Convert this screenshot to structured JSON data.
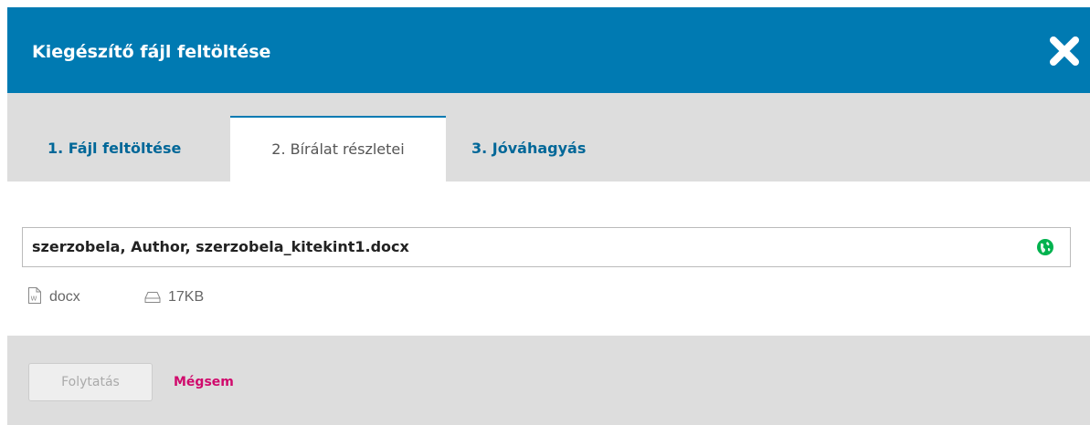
{
  "dialog": {
    "title": "Kiegészítő fájl feltöltése",
    "close_icon": "close-icon"
  },
  "tabs": [
    {
      "label": "1. Fájl feltöltése",
      "active": false
    },
    {
      "label": "2. Bírálat részletei",
      "active": true
    },
    {
      "label": "3. Jóváhagyás",
      "active": false
    }
  ],
  "file": {
    "name_value": "szerzobela, Author, szerzobela_kitekint1.docx",
    "language_icon": "globe-icon",
    "type": "docx",
    "type_icon": "word-file-icon",
    "size": "17KB",
    "size_icon": "hard-drive-icon"
  },
  "footer": {
    "continue_label": "Folytatás",
    "cancel_label": "Mégsem"
  },
  "colors": {
    "header_bg": "#007ab2",
    "tab_link": "#006798",
    "cancel_link": "#d00a6c",
    "globe": "#00b24e"
  }
}
